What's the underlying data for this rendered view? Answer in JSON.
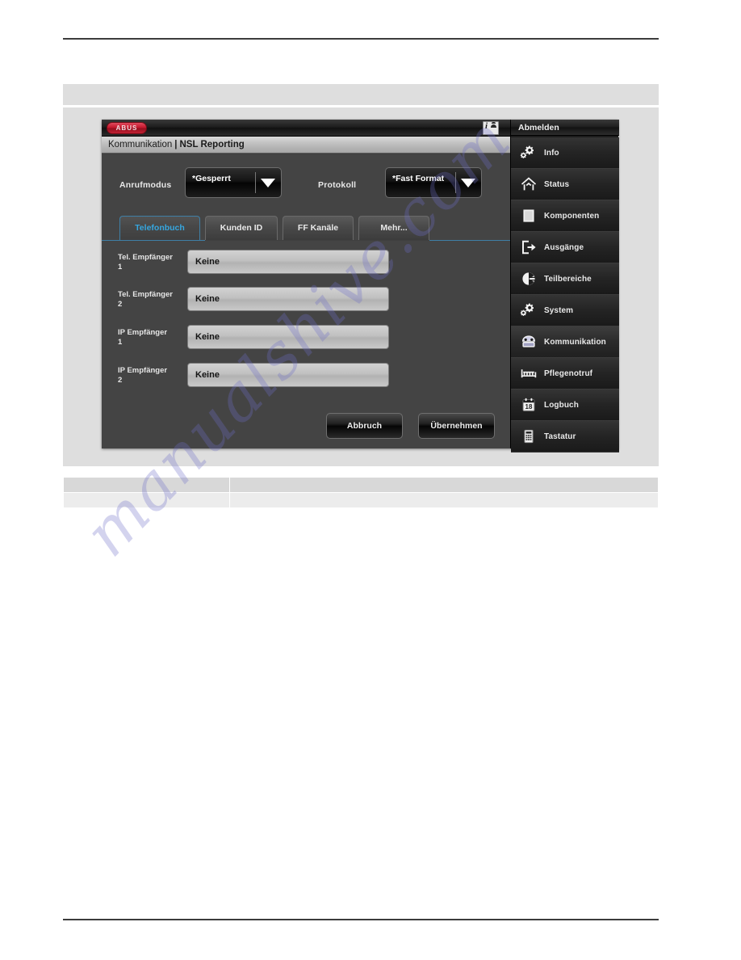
{
  "document": {
    "rules": {
      "top": true,
      "bottom": true
    },
    "watermark": "manualshive.com"
  },
  "device": {
    "titlebar": {
      "logo": "ABUS",
      "logo_icon": "abus-logo",
      "user_icon": "info-user-icon"
    },
    "breadcrumb": {
      "section": "Kommunikation",
      "separator": "|",
      "current": "NSL Reporting"
    },
    "selectors": [
      {
        "label": "Anrufmodus",
        "value": "*Gesperrt",
        "arrow_icon": "chevron-down-icon"
      },
      {
        "label": "Protokoll",
        "value": "*Fast Format",
        "arrow_icon": "chevron-down-icon"
      }
    ],
    "tabs": [
      {
        "label": "Telefonbuch",
        "active": true
      },
      {
        "label": "Kunden ID",
        "active": false
      },
      {
        "label": "FF Kanäle",
        "active": false
      },
      {
        "label": "Mehr...",
        "active": false
      }
    ],
    "fields": [
      {
        "label_line1": "Tel. Empfänger",
        "label_line2": "1",
        "value": "Keine"
      },
      {
        "label_line1": "Tel. Empfänger",
        "label_line2": "2",
        "value": "Keine"
      },
      {
        "label_line1": "IP Empfänger",
        "label_line2": "1",
        "value": "Keine"
      },
      {
        "label_line1": "IP Empfänger",
        "label_line2": "2",
        "value": "Keine"
      }
    ],
    "buttons": {
      "cancel": "Abbruch",
      "apply": "Übernehmen"
    },
    "sidebar": {
      "header": "Abmelden",
      "items": [
        {
          "label": "Info",
          "icon": "gears-icon"
        },
        {
          "label": "Status",
          "icon": "house-icon"
        },
        {
          "label": "Komponenten",
          "icon": "square-module-icon"
        },
        {
          "label": "Ausgänge",
          "icon": "exit-arrow-icon"
        },
        {
          "label": "Teilbereiche",
          "icon": "pie-segments-icon"
        },
        {
          "label": "System",
          "icon": "gears-icon"
        },
        {
          "label": "Kommunikation",
          "icon": "telephone-icon",
          "active": true
        },
        {
          "label": "Pflegenotruf",
          "icon": "bed-icon"
        },
        {
          "label": "Logbuch",
          "icon": "calendar-18-icon"
        },
        {
          "label": "Tastatur",
          "icon": "keypad-icon"
        }
      ]
    },
    "colors": {
      "accent_blue": "#36a7e0",
      "logo_red": "#c4172c",
      "panel_bg": "#444444",
      "sidebar_bg": "#1c1c1c"
    }
  },
  "bottom_table": {
    "rows": [
      {
        "type": "head",
        "cells": [
          "",
          ""
        ]
      },
      {
        "type": "body",
        "cells": [
          "",
          ""
        ]
      }
    ]
  }
}
